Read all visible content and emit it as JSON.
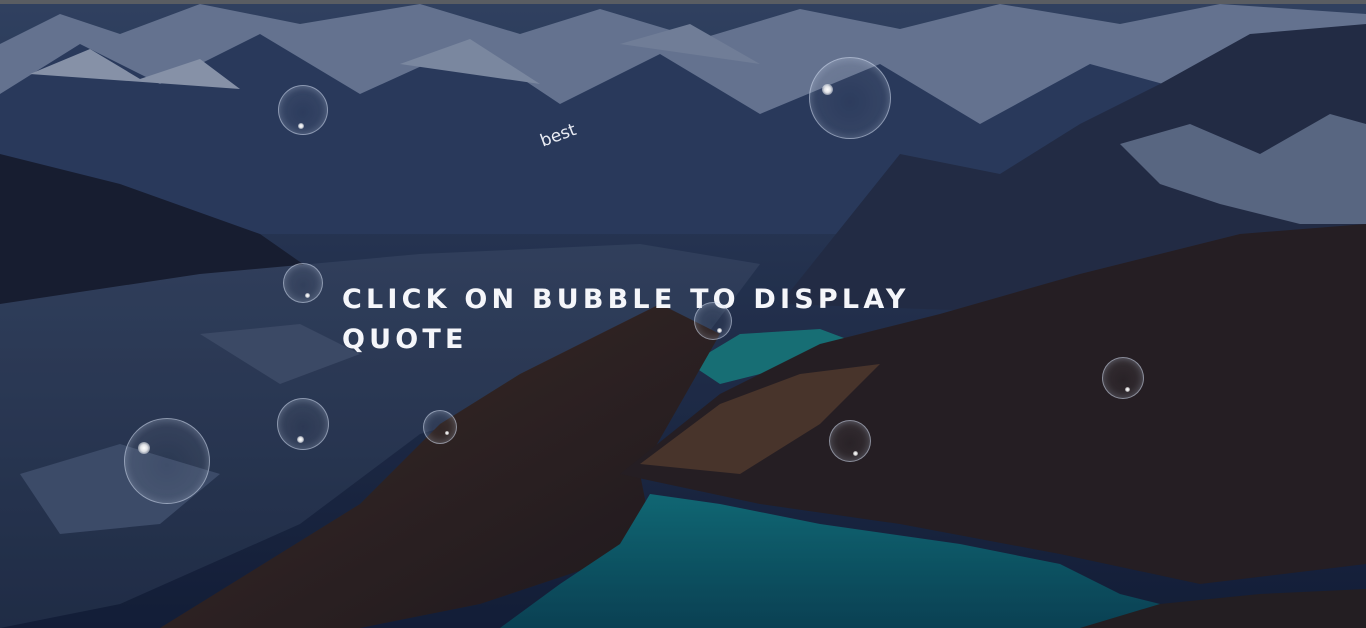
{
  "page": {
    "headline": "CLICK ON BUBBLE TO DISPLAY QUOTE",
    "floating_word": "best"
  },
  "colors": {
    "text": "#f5f6fa",
    "lake": "#0f6a78",
    "mountain_blue": "#1d2b4d",
    "mountain_brown": "#3a2a28"
  }
}
